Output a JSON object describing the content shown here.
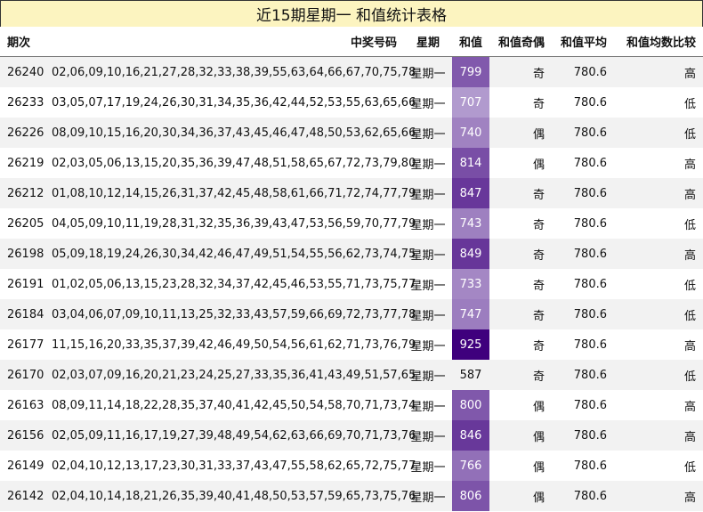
{
  "title": "近15期星期一 和值统计表格",
  "headers": {
    "issue": "期次",
    "numbers": "中奖号码",
    "weekday": "星期",
    "sum": "和值",
    "parity": "和值奇偶",
    "average": "和值平均",
    "compare": "和值均数比较"
  },
  "colors": {
    "sum_light": "#f0eefa",
    "sum_dark": "#3f007d",
    "sum_text_light": "#333333",
    "sum_text_dark": "#ffffff",
    "title_bg": "#fcf4c0"
  },
  "rows": [
    {
      "issue": "26240",
      "numbers": "02,06,09,10,16,21,27,28,32,33,38,39,55,63,64,66,67,70,75,78",
      "weekday": "星期一",
      "sum": "799",
      "parity": "奇",
      "average": "780.6",
      "compare": "高"
    },
    {
      "issue": "26233",
      "numbers": "03,05,07,17,19,24,26,30,31,34,35,36,42,44,52,53,55,63,65,66",
      "weekday": "星期一",
      "sum": "707",
      "parity": "奇",
      "average": "780.6",
      "compare": "低"
    },
    {
      "issue": "26226",
      "numbers": "08,09,10,15,16,20,30,34,36,37,43,45,46,47,48,50,53,62,65,66",
      "weekday": "星期一",
      "sum": "740",
      "parity": "偶",
      "average": "780.6",
      "compare": "低"
    },
    {
      "issue": "26219",
      "numbers": "02,03,05,06,13,15,20,35,36,39,47,48,51,58,65,67,72,73,79,80",
      "weekday": "星期一",
      "sum": "814",
      "parity": "偶",
      "average": "780.6",
      "compare": "高"
    },
    {
      "issue": "26212",
      "numbers": "01,08,10,12,14,15,26,31,37,42,45,48,58,61,66,71,72,74,77,79",
      "weekday": "星期一",
      "sum": "847",
      "parity": "奇",
      "average": "780.6",
      "compare": "高"
    },
    {
      "issue": "26205",
      "numbers": "04,05,09,10,11,19,28,31,32,35,36,39,43,47,53,56,59,70,77,79",
      "weekday": "星期一",
      "sum": "743",
      "parity": "奇",
      "average": "780.6",
      "compare": "低"
    },
    {
      "issue": "26198",
      "numbers": "05,09,18,19,24,26,30,34,42,46,47,49,51,54,55,56,62,73,74,75",
      "weekday": "星期一",
      "sum": "849",
      "parity": "奇",
      "average": "780.6",
      "compare": "高"
    },
    {
      "issue": "26191",
      "numbers": "01,02,05,06,13,15,23,28,32,34,37,42,45,46,53,55,71,73,75,77",
      "weekday": "星期一",
      "sum": "733",
      "parity": "奇",
      "average": "780.6",
      "compare": "低"
    },
    {
      "issue": "26184",
      "numbers": "03,04,06,07,09,10,11,13,25,32,33,43,57,59,66,69,72,73,77,78",
      "weekday": "星期一",
      "sum": "747",
      "parity": "奇",
      "average": "780.6",
      "compare": "低"
    },
    {
      "issue": "26177",
      "numbers": "11,15,16,20,33,35,37,39,42,46,49,50,54,56,61,62,71,73,76,79",
      "weekday": "星期一",
      "sum": "925",
      "parity": "奇",
      "average": "780.6",
      "compare": "高"
    },
    {
      "issue": "26170",
      "numbers": "02,03,07,09,16,20,21,23,24,25,27,33,35,36,41,43,49,51,57,65",
      "weekday": "星期一",
      "sum": "587",
      "parity": "奇",
      "average": "780.6",
      "compare": "低"
    },
    {
      "issue": "26163",
      "numbers": "08,09,11,14,18,22,28,35,37,40,41,42,45,50,54,58,70,71,73,74",
      "weekday": "星期一",
      "sum": "800",
      "parity": "偶",
      "average": "780.6",
      "compare": "高"
    },
    {
      "issue": "26156",
      "numbers": "02,05,09,11,16,17,19,27,39,48,49,54,62,63,66,69,70,71,73,76",
      "weekday": "星期一",
      "sum": "846",
      "parity": "偶",
      "average": "780.6",
      "compare": "高"
    },
    {
      "issue": "26149",
      "numbers": "02,04,10,12,13,17,23,30,31,33,37,43,47,55,58,62,65,72,75,77",
      "weekday": "星期一",
      "sum": "766",
      "parity": "偶",
      "average": "780.6",
      "compare": "低"
    },
    {
      "issue": "26142",
      "numbers": "02,04,10,14,18,21,26,35,39,40,41,48,50,53,57,59,65,73,75,76",
      "weekday": "星期一",
      "sum": "806",
      "parity": "偶",
      "average": "780.6",
      "compare": "高"
    }
  ]
}
